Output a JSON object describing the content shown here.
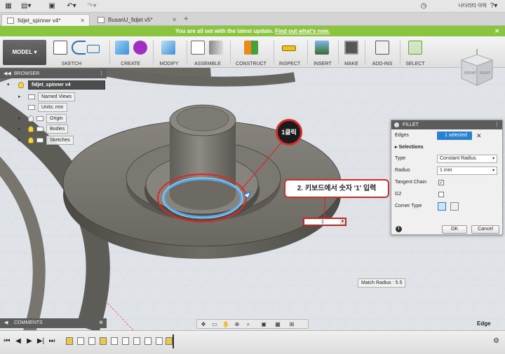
{
  "app": {
    "user_name": "나다라타 아하",
    "icons": [
      "grid-icon",
      "file-icon",
      "save-icon",
      "undo-icon",
      "redo-icon",
      "clock-icon",
      "help-icon"
    ]
  },
  "tabs": [
    {
      "label": "fidjet_spinner v4*",
      "active": true
    },
    {
      "label": "BusanU_fidjet v5*",
      "active": false
    }
  ],
  "update_bar": {
    "message": "You are all set with the latest update.",
    "link": "Find out what's new."
  },
  "toolbar": {
    "workspace": "MODEL",
    "groups": [
      "SKETCH",
      "CREATE",
      "MODIFY",
      "ASSEMBLE",
      "CONSTRUCT",
      "INSPECT",
      "INSERT",
      "MAKE",
      "ADD-INS",
      "SELECT"
    ]
  },
  "browser": {
    "title": "BROWSER",
    "root": "fidjet_spinner v4",
    "items": [
      "Named Views",
      "Units: mm",
      "Origin",
      "Bodies",
      "Sketches"
    ]
  },
  "fillet": {
    "title": "FILLET",
    "edges_label": "Edges",
    "edges_value": "1 selected",
    "selections_label": "Selections",
    "type_label": "Type",
    "type_value": "Constant Radius",
    "radius_label": "Radius",
    "radius_value": "1 mm",
    "tangent_label": "Tangent Chain",
    "tangent_checked": true,
    "g2_label": "G2",
    "g2_checked": false,
    "corner_label": "Corner Type",
    "ok": "OK",
    "cancel": "Cancel"
  },
  "callouts": {
    "click": "1클릭",
    "step2": "2. 키보드에서 숫자 '1' 입력"
  },
  "viewport": {
    "radius_input_value": "1",
    "match_radius": "Match Radius : 5.5",
    "selection_mode": "Edge",
    "viewcube_faces": [
      "FRONT",
      "RIGHT"
    ]
  },
  "bottom": {
    "comments": "COMMENTS"
  },
  "colors": {
    "accent_blue": "#2a7fd1",
    "update_green": "#8bc53f",
    "callout_red": "#d42b2b",
    "body_gray": "#6f6d66"
  }
}
